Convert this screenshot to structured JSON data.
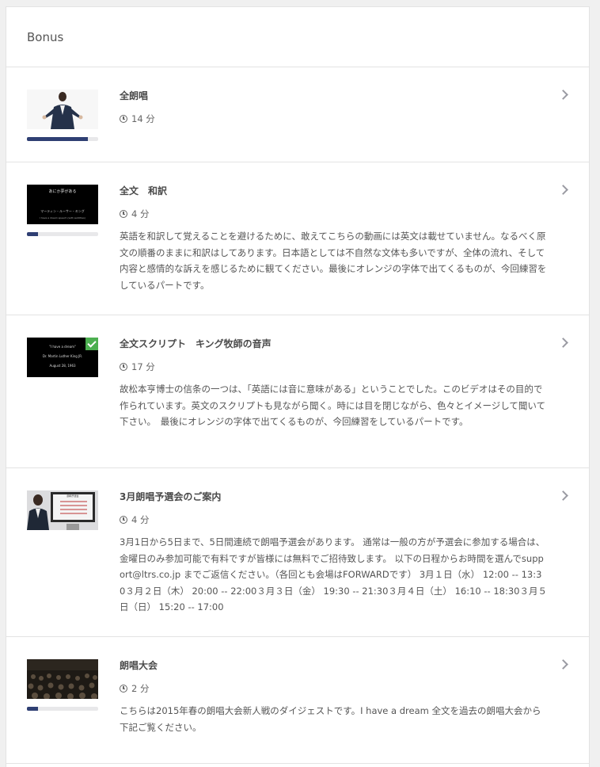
{
  "header": {
    "title": "Bonus"
  },
  "lessons": [
    {
      "title": "全朗唱",
      "duration": "14 分",
      "progress": 0.85,
      "description": "",
      "completed": false
    },
    {
      "title": "全文　和訳",
      "duration": "4 分",
      "progress": 0.15,
      "description": "英語を和訳して覚えることを避けるために、敢えてこちらの動画には英文は載せていません。なるべく原文の順番のままに和訳はしてあります。日本語としては不自然な文体も多いですが、全体の流れ、そして内容と感情的な訴えを感じるために観てください。最後にオレンジの字体で出てくるものが、今回練習をしているパートです。",
      "completed": false,
      "thumb_text": [
        "あにか夢がある",
        "マーティン・ルーサー・キング",
        "I have a dream speech (with subtitles)"
      ]
    },
    {
      "title": "全文スクリプト　キング牧師の音声",
      "duration": "17 分",
      "progress": null,
      "description": "故松本亨博士の信条の一つは、「英語には音に意味がある」ということでした。このビデオはその目的で作られています。英文のスクリプトも見ながら聞く。時には目を閉じながら、色々とイメージして聞いて下さい。　最後にオレンジの字体で出てくるものが、今回練習をしているパートです。",
      "completed": true,
      "thumb_text": [
        "\"I have a dream\"",
        "Dr. Martin Luther King JR.",
        "August 28, 1963"
      ]
    },
    {
      "title": "3月朗唱予選会のご案内",
      "duration": "4 分",
      "progress": null,
      "description": "3月1日から5日まで、5日間連続で朗唱予選会があります。 通常は一般の方が予選会に参加する場合は、金曜日のみ参加可能で有料ですが皆様には無料でご招待致します。 以下の日程からお時間を選んでsupport@ltrs.co.jp までご返信ください。（各回とも会場はFORWARDです） 3月１日（水） 12:00 -- 13:30３月２日（木） 20:00 -- 22:00３月３日（金） 19:30 -- 21:30３月４日（土） 16:10 -- 18:30３月５日（日） 15:20 -- 17:00",
      "completed": false,
      "thumb_text": [
        "朗唱予選会"
      ]
    },
    {
      "title": "朗唱大会",
      "duration": "2 分",
      "progress": 0.15,
      "description": "こちらは2015年春の朗唱大会新人戦のダイジェストです。I have a dream 全文を過去の朗唱大会から下記ご覧ください。",
      "completed": false
    }
  ],
  "colors": {
    "progress_fill": "#2f3f73",
    "progress_track": "#e8e8ea",
    "check_badge": "#4caf50",
    "border": "#e3e3e3"
  }
}
